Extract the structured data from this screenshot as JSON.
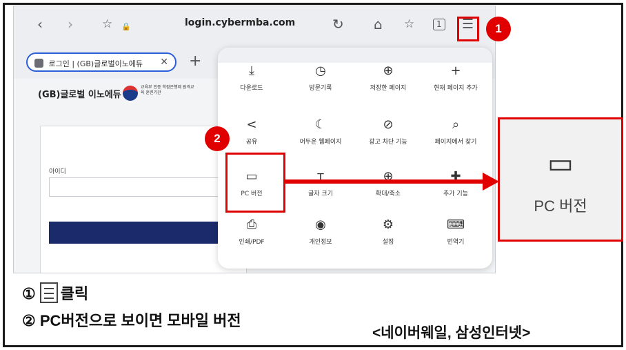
{
  "browser": {
    "url": "login.cybermba.com",
    "tab_title": "로그인 | (GB)글로벌이노에듀",
    "tab_close": "✕",
    "new_tab": "+",
    "nav_back": "‹",
    "nav_forward": "›",
    "bookmark_star": "☆",
    "lock": "🔒",
    "reload": "↻",
    "home": "⌂",
    "favorites": "☆",
    "tabs_count": "1",
    "menu_icon": "☰"
  },
  "page": {
    "logo_text": "(GB)글로벌 이노에듀",
    "logo_sub": "교육부 인증 학점은행제 원격교육 훈련기관",
    "id_label": "아이디"
  },
  "menu": {
    "items": [
      {
        "icon": "⤓",
        "label": "다운로드"
      },
      {
        "icon": "◷",
        "label": "방문기록"
      },
      {
        "icon": "⊕",
        "label": "저장한 페이지"
      },
      {
        "icon": "+",
        "label": "현재 페이지 추가"
      },
      {
        "icon": "<",
        "label": "공유"
      },
      {
        "icon": "☾",
        "label": "어두운 웹페이지"
      },
      {
        "icon": "⊘",
        "label": "광고 차단 기능"
      },
      {
        "icon": "⌕",
        "label": "페이지에서 찾기"
      },
      {
        "icon": "▭",
        "label": "PC 버전"
      },
      {
        "icon": "ᴛ",
        "label": "글자 크기"
      },
      {
        "icon": "⊕",
        "label": "확대/축소"
      },
      {
        "icon": "✚",
        "label": "추가 기능"
      },
      {
        "icon": "⎙",
        "label": "인쇄/PDF"
      },
      {
        "icon": "◉",
        "label": "개인정보"
      },
      {
        "icon": "⚙",
        "label": "설정"
      },
      {
        "icon": "⌨",
        "label": "번역기"
      }
    ]
  },
  "callouts": {
    "badge1": "1",
    "badge2": "2",
    "zoom_label": "PC 버전",
    "zoom_icon": "▭"
  },
  "instructions": {
    "step1_prefix": "①",
    "step1_suffix": "클릭",
    "step2": "② PC버전으로 보이면 모바일 버전",
    "browsers": "<네이버웨일, 삼성인터넷>"
  },
  "colors": {
    "highlight": "#e00000",
    "tab_border": "#2b5fd9",
    "login_button": "#1b2a6b"
  }
}
